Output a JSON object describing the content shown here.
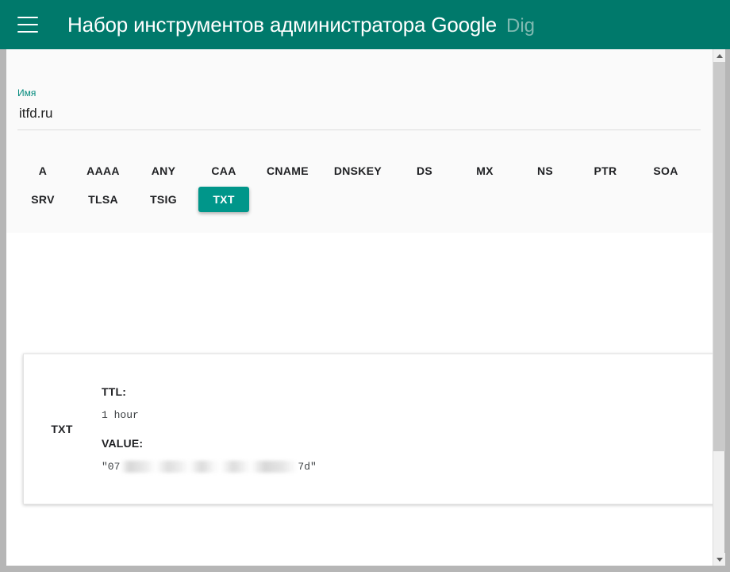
{
  "appbar": {
    "menu_icon": "hamburger-menu-icon",
    "title": "Набор инструментов администратора Google",
    "subtitle": "Dig",
    "background_color": "#00796b",
    "title_color": "#ffffff",
    "subtitle_color": "#7fb9b1"
  },
  "search": {
    "name_field": {
      "label": "Имя",
      "value": "itfd.ru",
      "placeholder": "Имя"
    },
    "record_types_row1": [
      "A",
      "AAAA",
      "ANY",
      "CAA",
      "CNAME",
      "DNSKEY",
      "DS",
      "MX",
      "NS",
      "PTR",
      "SOA"
    ],
    "record_types_row2": [
      "SRV",
      "TLSA",
      "TSIG",
      "TXT"
    ],
    "selected_type": "TXT",
    "selected_color": "#00968a"
  },
  "results": {
    "records": [
      {
        "type": "TXT",
        "ttl_key": "TTL:",
        "ttl_value": "1 hour",
        "value_key": "VALUE:",
        "value_prefix": "\"07",
        "value_redacted": true,
        "value_suffix": "7d\""
      }
    ]
  },
  "scrollbar": {
    "up_icon": "chevron-up-icon",
    "down_icon": "chevron-down-icon",
    "thumb": "scrollbar-thumb"
  }
}
